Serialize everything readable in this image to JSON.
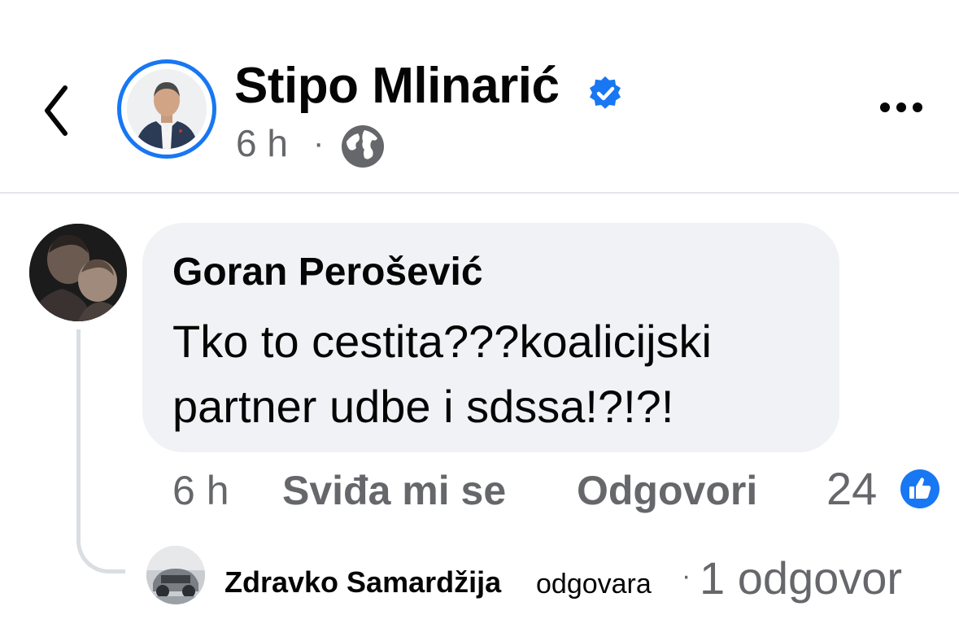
{
  "post": {
    "author_name": "Stipo Mlinarić",
    "time": "6 h",
    "separator": "·",
    "audience_icon": "globe-icon",
    "verified_icon": "verified-badge-icon"
  },
  "comment": {
    "author_name": "Goran Perošević",
    "text": "Tko to cestita???koalicijski partner udbe i sdssa!?!?!",
    "time": "6 h",
    "like_label": "Sviđa mi se",
    "reply_label": "Odgovori",
    "reaction_count": "24",
    "reaction_icon": "thumbs-up-icon"
  },
  "reply_preview": {
    "author_name": "Zdravko Samardžija",
    "action": "odgovara",
    "separator": "·",
    "replies_label": "1 odgovor"
  },
  "colors": {
    "accent_blue": "#1877f2",
    "secondary_text": "#65676b",
    "bubble_bg": "#f0f2f5",
    "divider": "#e4e6eb"
  }
}
